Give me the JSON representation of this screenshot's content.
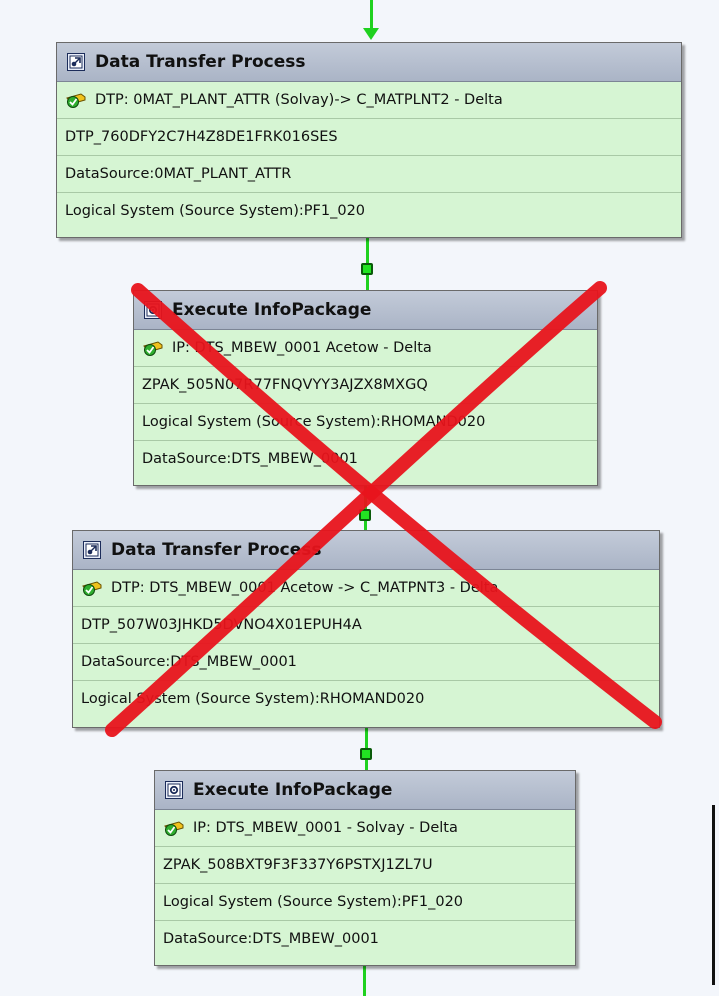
{
  "boxes": [
    {
      "header": "Data Transfer Process",
      "icon": "dtp-icon",
      "rows": [
        "DTP: 0MAT_PLANT_ATTR (Solvay)-> C_MATPLNT2 - Delta",
        "DTP_760DFY2C7H4Z8DE1FRK016SES",
        "DataSource:0MAT_PLANT_ATTR",
        "Logical System (Source System):PF1_020"
      ]
    },
    {
      "header": "Execute InfoPackage",
      "icon": "infopackage-icon",
      "rows": [
        "IP: DTS_MBEW_0001 Acetow - Delta",
        "ZPAK_505N07R77FNQVYY3AJZX8MXGQ",
        "Logical System (Source System):RHOMAND020",
        "DataSource:DTS_MBEW_0001"
      ]
    },
    {
      "header": "Data Transfer Process",
      "icon": "dtp-icon",
      "rows": [
        "DTP: DTS_MBEW_0001 Acetow -> C_MATPNT3 - Delta",
        "DTP_507W03JHKD5DVNO4X01EPUH4A",
        "DataSource:DTS_MBEW_0001",
        "Logical System (Source System):RHOMAND020"
      ]
    },
    {
      "header": "Execute InfoPackage",
      "icon": "infopackage-icon",
      "rows": [
        "IP: DTS_MBEW_0001 - Solvay - Delta",
        "ZPAK_508BXT9F3F337Y6PSTXJ1ZL7U",
        "Logical System (Source System):PF1_020",
        "DataSource:DTS_MBEW_0001"
      ]
    }
  ],
  "colors": {
    "connector": "#1fd11f",
    "box_body": "#d6f5d3",
    "header": "#b7c0d0",
    "cross_out": "#e8141c"
  }
}
